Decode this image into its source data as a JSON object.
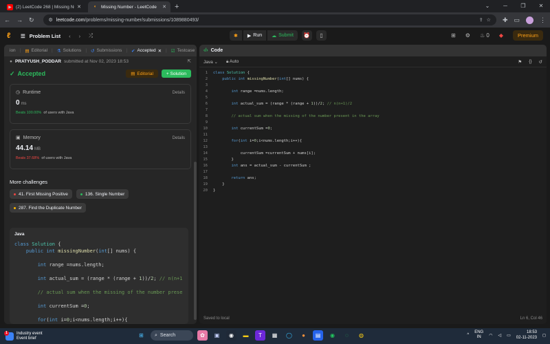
{
  "browser": {
    "tabs": [
      {
        "title": "(2) LeetCode 268 | Missing Num",
        "favicon": "youtube-icon"
      },
      {
        "title": "Missing Number - LeetCode",
        "favicon": "leetcode-icon"
      }
    ],
    "url_domain": "leetcode.com",
    "url_path": "/problems/missing-number/submissions/1089880493/"
  },
  "lc_header": {
    "problem_list": "Problem List",
    "run": "Run",
    "submit": "Submit",
    "fire_count": "0",
    "premium": "Premium"
  },
  "left_tabs": [
    {
      "label": "Editorial",
      "on": false
    },
    {
      "label": "Solutions",
      "on": false
    },
    {
      "label": "Submissions",
      "on": false
    },
    {
      "label": "Accepted",
      "on": true
    },
    {
      "label": "Testcase",
      "on": false
    }
  ],
  "submission": {
    "user": "PRATYUSH_PODDAR",
    "submitted_text": "submitted at Nov 02, 2023 18:53",
    "status": "Accepted",
    "editorial_btn": "Editorial",
    "solution_btn": "+ Solution"
  },
  "runtime": {
    "label": "Runtime",
    "details": "Details",
    "value": "0",
    "unit": "ms",
    "beats_pct": "Beats 100.00%",
    "beats_rest": "of users with Java"
  },
  "memory": {
    "label": "Memory",
    "details": "Details",
    "value": "44.14",
    "unit": "MB",
    "beats_pct": "Beats 37.68%",
    "beats_rest": "of users with Java"
  },
  "more_challenges": {
    "title": "More challenges",
    "items": [
      {
        "label": "41. First Missing Positive",
        "color": "#ef4743"
      },
      {
        "label": "136. Single Number",
        "color": "#2cbb5d"
      },
      {
        "label": "287. Find the Duplicate Number",
        "color": "#ffb800"
      }
    ]
  },
  "code_card": {
    "lang": "Java",
    "lines": [
      "class Solution {",
      "    public int missingNumber(int[] nums) {",
      "",
      "        int range =nums.length;",
      "",
      "        int actual_sum = (range * (range + 1))/2; // n(n+1",
      "",
      "        // actual sum when the missing of the number prese",
      "",
      "        int currentSum =0;",
      "",
      "        for(int i=0;i<nums.length;i++){"
    ]
  },
  "editor": {
    "title": "Code",
    "language": "Java",
    "mode": "Auto",
    "footer_left": "Saved to local",
    "footer_right": "Ln 6, Col 46",
    "lines": [
      "class Solution {",
      "    public int missingNumber(int[] nums) {",
      "",
      "        int range =nums.length;",
      "",
      "        int actual_sum = (range * (range + 1))/2; // n(n+1)/2",
      "",
      "        // actual sum when the missing of the number present in the array",
      "",
      "        int currentSum =0;",
      "",
      "        for(int i=0;i<nums.length;i++){",
      "",
      "            currentSum =currentSum + nums[i];",
      "        }",
      "        int ans = actual_sum - currentSum ;",
      "",
      "        return ans;",
      "    }",
      "}"
    ]
  },
  "taskbar": {
    "weather_title": "Industry event",
    "weather_sub": "Event brief",
    "badge": "1",
    "search": "Search",
    "lang1": "ENG",
    "lang2": "IN",
    "time": "18:53",
    "date": "02-11-2023"
  }
}
